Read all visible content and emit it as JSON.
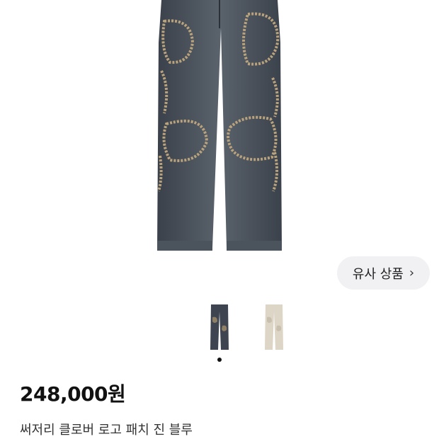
{
  "product": {
    "image_name": "denim-pants-image",
    "similar_label": "유사 상품",
    "similar_icon": "chevron-right-icon",
    "thumbnails": [
      {
        "name": "blue-denim",
        "color": "#3e4550"
      },
      {
        "name": "cream",
        "color": "#ddd5c6"
      }
    ],
    "active_index": 0,
    "price": "248,000원",
    "name": "써저리 클로버 로고 패치 진 블루"
  }
}
